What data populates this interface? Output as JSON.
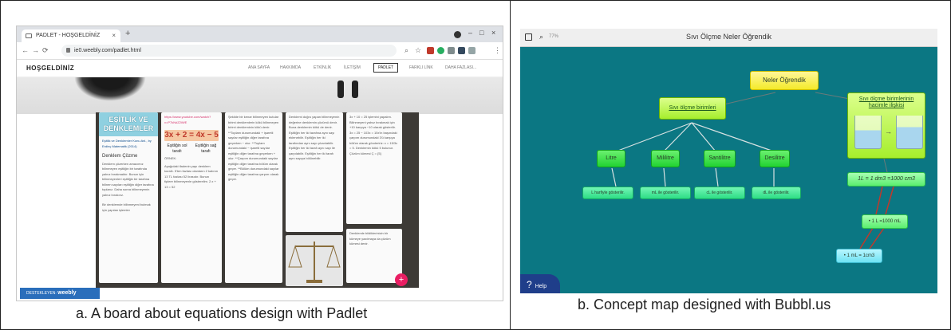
{
  "panel_a": {
    "browser": {
      "tab_title": "PADLET - HOŞGELDİNİZ",
      "tab_close": "×",
      "new_tab": "+",
      "url": "ie0.weebly.com/padlet.html",
      "win_min": "–",
      "win_max": "□",
      "win_close": "×"
    },
    "site": {
      "title": "HOŞGELDİNİZ",
      "menu": [
        "ANA SAYFA",
        "HAKKIMDA",
        "ETKİNLİK",
        "İLETİŞİM",
        "PADLET",
        "FARKLI LİNK",
        "DAHA FAZLASI..."
      ],
      "active_menu_index": 4
    },
    "board": {
      "card1_title": "EŞİTLİK VE DENKLEMLER",
      "card1_sub": "Eşitlik ve Denklemler Konu Anl., by Erdinç Matematik (2014)",
      "card1_heading": "Denklem Çözme",
      "card1_text": "Denklem çözerken amacımız bilinmeyen eşitliğin bir tarafında yalnız bırakmaktır. Bunun için bilinmeyenleri eşitliğin bir tarafına bilinen sayıları eşitliğin diğer tarafına toplarız. Daha sonra bilinmeyenin yalnız bırakırız.",
      "card1_text2": "Bir denklemde bilinmeyeni bulmak için yapılan işlemler",
      "card2_link": "https://www.youtube.com/watch?v=P7kNdZ2iWE",
      "card2_equation": "3x + 2 = 4x − 5",
      "card2_label_left": "Eşitliğin sol tarafı",
      "card2_label_right": "Eşitliğin sağ tarafı",
      "card2_heading": "ÖRNEK:",
      "card2_text": "Aşağıdaki ifadenin yapı denklem kurallı. 5'ten fazlası olanların 2 katının 13 TL fazlası 52 lirasıdır. Bunun tiplere bilinmeyenle gösterelim. 2.x + 13 = 52",
      "card3_text": "Şekilde bir kenar bilinmeyen kutular birimi denklemlerin kökü bilinmeyen birimi denkleminin kökü denir. **Toplam durumundaki + işaretli sayılar eşitliğin diğer tarafına geçerken − olur. **Toplam durumundaki − işaretli sayılar eşitliğin diğer tarafına geçerken + olur. **Çarpım durumundaki sayılar eşitliğin diğer tarafına bölüm olarak geçer. **Bölüm durumundaki sayılar eşitliğin diğer tarafına çarpım olarak geçer.",
      "card4_text": "Denklemi doğru yapan bilinmeyenin değerine denklemin çözümü denir. Buna denklemin kökü de denir. Eşitliğin her iki tarafına aynı sayı eklenebilir. Eşitliğin her iki tarafından aynı sayı çıkarılabilir. Eşitliğin her iki tarafı aynı sayı ile çarpılabilir. Eşitliğin her iki tarafı aynı sayıya bölünebilir.",
      "card5_text": "3x + 10 = 25 işlemini yapalım. Bilinmeyeni yalnız bırakmak için +10 karşıya −10 olarak gösterilir. 3x = 25 − 103x = 15x'in başındaki çarpım durumundaki 3'ü karşıya bölüm olarak göndeririz: x = 15/3x = 5. Denklemin kökü 5 bulunur. Çözüm kümesi Ç = {5}",
      "card5_text2": "Denklemle bildiklerinizin bir kümeye yazılmaya da çözüm kümesi denir.",
      "fab": "+",
      "weebly_text": "DESTEKLEYEN",
      "weebly_brand": "weebly"
    },
    "caption": "a. A board about equations design with Padlet"
  },
  "panel_b": {
    "title": "Sıvı Ölçme Neler Öğrendik",
    "zoom": "77%",
    "nodes": {
      "root": "Neler Öğrendik",
      "units": "Sıvı ölçme birimleri",
      "volume": "Sıvı ölçme birimlerinin hacimle ilişkisi",
      "arrow": "→",
      "litre": "Litre",
      "mililitre": "Mililitre",
      "santilitre": "Santilitre",
      "desilitre": "Desilitre",
      "litre_desc": "L harfiyle gösterilir.",
      "mililitre_desc": "mL ile gösterilir.",
      "santilitre_desc": "cL ile gösterilir.",
      "desilitre_desc": "dL ile gösterilir.",
      "equation": "1L = 1 dm3 =1000 cm3",
      "l_to_ml": "• 1 L =1000 mL",
      "ml_to_cm3": "• 1 mL = 1cm3"
    },
    "help": "Help",
    "help_icon": "?",
    "caption": "b. Concept map designed with Bubbl.us"
  }
}
